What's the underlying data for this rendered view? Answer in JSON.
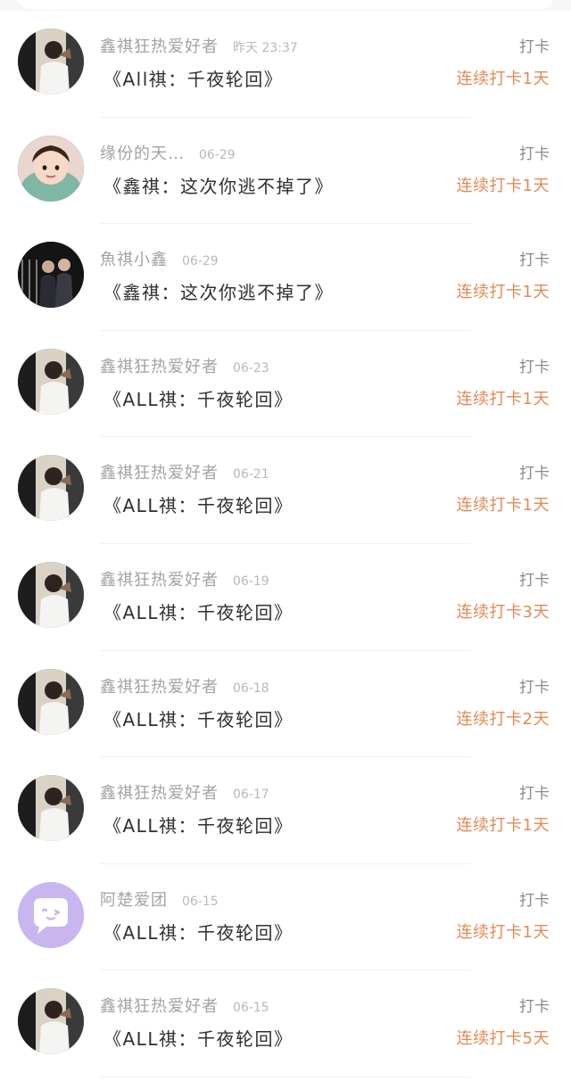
{
  "checkins": [
    {
      "avatar": "photo-avatar-icon",
      "username": "鑫祺狂热爱好者",
      "time": "昨天 23:37",
      "title": "《All祺：千夜轮回》",
      "tag": "打卡",
      "streak": "连续打卡1天"
    },
    {
      "avatar": "girl-photo-avatar-icon",
      "username": "缘份的天…",
      "time": "06-29",
      "title": "《鑫祺：这次你逃不掉了》",
      "tag": "打卡",
      "streak": "连续打卡1天"
    },
    {
      "avatar": "group-photo-avatar-icon",
      "username": "魚祺小鑫",
      "time": "06-29",
      "title": "《鑫祺：这次你逃不掉了》",
      "tag": "打卡",
      "streak": "连续打卡1天"
    },
    {
      "avatar": "photo-avatar-icon",
      "username": "鑫祺狂热爱好者",
      "time": "06-23",
      "title": "《ALL祺：千夜轮回》",
      "tag": "打卡",
      "streak": "连续打卡1天"
    },
    {
      "avatar": "photo-avatar-icon",
      "username": "鑫祺狂热爱好者",
      "time": "06-21",
      "title": "《ALL祺：千夜轮回》",
      "tag": "打卡",
      "streak": "连续打卡1天"
    },
    {
      "avatar": "photo-avatar-icon",
      "username": "鑫祺狂热爱好者",
      "time": "06-19",
      "title": "《ALL祺：千夜轮回》",
      "tag": "打卡",
      "streak": "连续打卡3天"
    },
    {
      "avatar": "photo-avatar-icon",
      "username": "鑫祺狂热爱好者",
      "time": "06-18",
      "title": "《ALL祺：千夜轮回》",
      "tag": "打卡",
      "streak": "连续打卡2天"
    },
    {
      "avatar": "photo-avatar-icon",
      "username": "鑫祺狂热爱好者",
      "time": "06-17",
      "title": "《ALL祺：千夜轮回》",
      "tag": "打卡",
      "streak": "连续打卡1天"
    },
    {
      "avatar": "chat-bubble-avatar-icon",
      "username": "阿楚爱团",
      "time": "06-15",
      "title": "《ALL祺：千夜轮回》",
      "tag": "打卡",
      "streak": "连续打卡1天"
    },
    {
      "avatar": "photo-avatar-icon",
      "username": "鑫祺狂热爱好者",
      "time": "06-15",
      "title": "《ALL祺：千夜轮回》",
      "tag": "打卡",
      "streak": "连续打卡5天"
    }
  ],
  "colors": {
    "streak": "#e38a55",
    "username": "#a3a3a3",
    "chat_avatar_bg": "#c9b6ef"
  }
}
